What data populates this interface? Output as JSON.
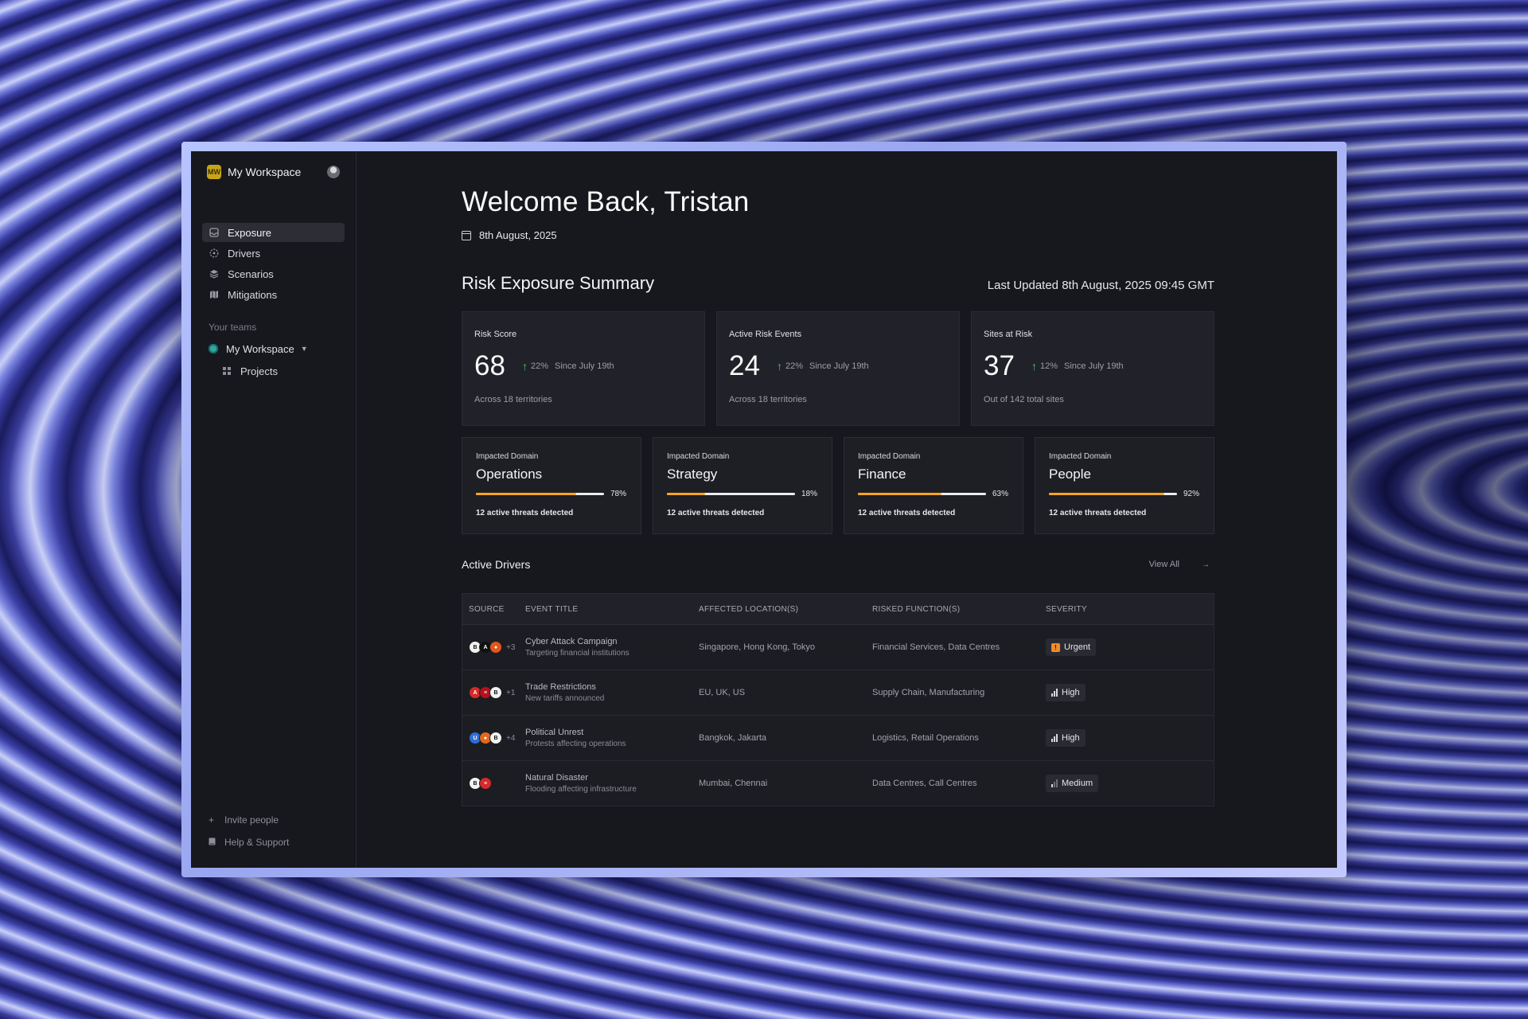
{
  "sidebar": {
    "workspace": {
      "initials": "MW",
      "name": "My Workspace"
    },
    "nav": [
      {
        "label": "Exposure",
        "icon": "inbox-icon",
        "active": true
      },
      {
        "label": "Drivers",
        "icon": "target-icon",
        "active": false
      },
      {
        "label": "Scenarios",
        "icon": "layers-icon",
        "active": false
      },
      {
        "label": "Mitigations",
        "icon": "map-icon",
        "active": false
      }
    ],
    "teams_label": "Your teams",
    "team": {
      "name": "My Workspace"
    },
    "projects_label": "Projects",
    "invite_label": "Invite people",
    "help_label": "Help & Support"
  },
  "main": {
    "welcome": "Welcome Back, Tristan",
    "date": "8th August, 2025",
    "summary_title": "Risk Exposure Summary",
    "last_updated": "Last Updated 8th August, 2025 09:45 GMT",
    "stats": [
      {
        "label": "Risk Score",
        "value": "68",
        "pct": "22%",
        "since": "Since July 19th",
        "sub": "Across 18 territories"
      },
      {
        "label": "Active Risk Events",
        "value": "24",
        "pct": "22%",
        "since": "Since July 19th",
        "sub": "Across 18 territories"
      },
      {
        "label": "Sites at Risk",
        "value": "37",
        "pct": "12%",
        "since": "Since July 19th",
        "sub": "Out of 142 total sites"
      }
    ],
    "domains": [
      {
        "label": "Impacted Domain",
        "name": "Operations",
        "pct_label": "78%",
        "fill": 0.78,
        "threats": "12 active threats detected"
      },
      {
        "label": "Impacted Domain",
        "name": "Strategy",
        "pct_label": "18%",
        "fill": 0.3,
        "threats": "12 active threats detected"
      },
      {
        "label": "Impacted Domain",
        "name": "Finance",
        "pct_label": "63%",
        "fill": 0.65,
        "threats": "12 active threats detected"
      },
      {
        "label": "Impacted Domain",
        "name": "People",
        "pct_label": "92%",
        "fill": 0.9,
        "threats": "12 active threats detected"
      }
    ],
    "drivers": {
      "title": "Active Drivers",
      "view_all": "View All",
      "columns": [
        "SOURCE",
        "EVENT TITLE",
        "AFFECTED LOCATION(S)",
        "RISKED FUNCTION(S)",
        "SEVERITY"
      ],
      "rows": [
        {
          "more": "+3",
          "title": "Cyber Attack Campaign",
          "subtitle": "Targeting financial institutions",
          "locations": "Singapore, Hong Kong, Tokyo",
          "functions": "Financial Services, Data Centres",
          "severity": "Urgent"
        },
        {
          "more": "+1",
          "title": "Trade Restrictions",
          "subtitle": "New tariffs announced",
          "locations": "EU, UK, US",
          "functions": "Supply Chain, Manufacturing",
          "severity": "High"
        },
        {
          "more": "+4",
          "title": "Political Unrest",
          "subtitle": "Protests affecting operations",
          "locations": "Bangkok, Jakarta",
          "functions": "Logistics, Retail Operations",
          "severity": "High"
        },
        {
          "more": "",
          "title": "Natural Disaster",
          "subtitle": "Flooding affecting infrastructure",
          "locations": "Mumbai, Chennai",
          "functions": "Data Centres, Call Centres",
          "severity": "Medium"
        }
      ]
    }
  },
  "colors": {
    "accent": "#f5a524",
    "positive": "#3ecf6e",
    "urgent": "#f08a2a",
    "bg": "#17181e"
  }
}
